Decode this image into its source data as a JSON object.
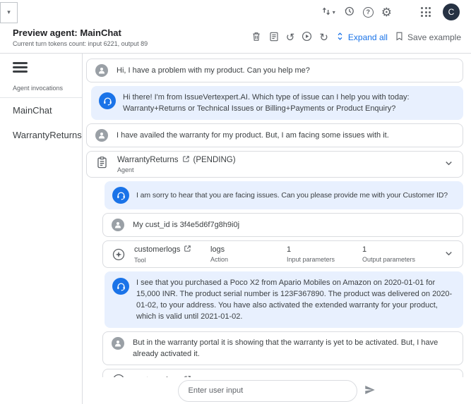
{
  "topbar": {
    "avatar_letter": "C"
  },
  "header": {
    "title": "Preview agent: MainChat",
    "subtitle": "Current turn tokens count: input 6221, output 89",
    "expand_all_label": "Expand all",
    "save_example_label": "Save example"
  },
  "sidebar": {
    "section_label": "Agent invocations",
    "items": [
      {
        "label": "MainChat"
      },
      {
        "label": "WarrantyReturns"
      }
    ]
  },
  "chat": {
    "messages": [
      {
        "type": "user",
        "text": "Hi, I have a problem with my product. Can you help me?"
      },
      {
        "type": "agent",
        "text": "Hi there! I'm from IssueVertexpert.AI. Which type of issue can I help you with today: Warranty+Returns or Technical Issues or Billing+Payments or Product Enquiry?"
      },
      {
        "type": "user",
        "text": "I have availed the warranty for my product. But, I am facing some issues with it."
      },
      {
        "type": "agent_invocation",
        "name": "WarrantyReturns",
        "status": "(PENDING)",
        "role": "Agent"
      },
      {
        "type": "agent",
        "text": "I am sorry to hear that you are facing issues. Can you please provide me with your Customer ID?"
      },
      {
        "type": "user",
        "text": "My cust_id is 3f4e5d6f7g8h9i0j"
      },
      {
        "type": "tool",
        "name": "customerlogs",
        "role": "Tool",
        "action_value": "logs",
        "action_label": "Action",
        "input_value": "1",
        "input_label": "Input parameters",
        "output_value": "1",
        "output_label": "Output parameters"
      },
      {
        "type": "agent",
        "text": "I see that you purchased a Poco X2 from Apario Mobiles on Amazon on 2020-01-01 for 15,000 INR. The product serial number is 123F367890. The product was delivered on 2020-01-02, to your address. You have also activated the extended warranty for your product, which is valid until 2021-01-02."
      },
      {
        "type": "user",
        "text": "But in the warranty portal it is showing that the warranty is yet to be activated. But, I have already activated it."
      },
      {
        "type": "tool",
        "name": "customerlogs"
      }
    ]
  },
  "composer": {
    "placeholder": "Enter user input"
  },
  "icons": {
    "undo": "↺",
    "redo": "↻",
    "settings": "⚙",
    "caret_down": "▾",
    "help": "?"
  },
  "colors": {
    "accent": "#1a73e8",
    "agent_bubble": "#e8f0fe",
    "border": "#dadce0",
    "text_primary": "#202124",
    "text_secondary": "#5f6368",
    "avatar_bg": "#263243"
  }
}
